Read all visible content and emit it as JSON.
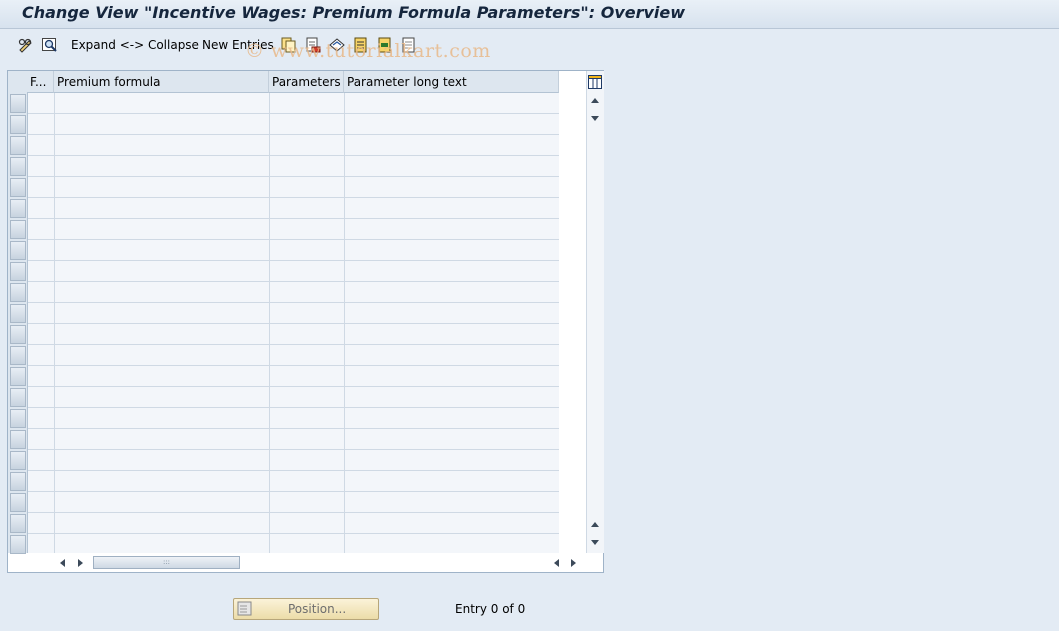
{
  "window": {
    "title": "Change View \"Incentive Wages: Premium Formula Parameters\": Overview"
  },
  "toolbar": {
    "icons_left": [
      "edit-glasses-icon",
      "find-icon"
    ],
    "expand_collapse_label": "Expand <-> Collapse",
    "new_entries_label": "New Entries",
    "icons_right": [
      "copy-icon",
      "delete-icon",
      "undo-icon",
      "select-all-icon",
      "select-block-icon",
      "deselect-all-icon"
    ]
  },
  "watermark": "© www.tutorialkart.com",
  "table": {
    "columns": [
      {
        "label": "F..."
      },
      {
        "label": "Premium formula"
      },
      {
        "label": "Parameters"
      },
      {
        "label": "Parameter long text"
      }
    ],
    "rows": [],
    "visible_empty_rows": 22,
    "config_icon": "table-settings-icon"
  },
  "footer": {
    "position_button_label": "Position...",
    "entry_text": "Entry 0 of 0"
  },
  "colors": {
    "background": "#e3ebf4",
    "title": "#15263d",
    "position_button": "#f3e7bd"
  }
}
